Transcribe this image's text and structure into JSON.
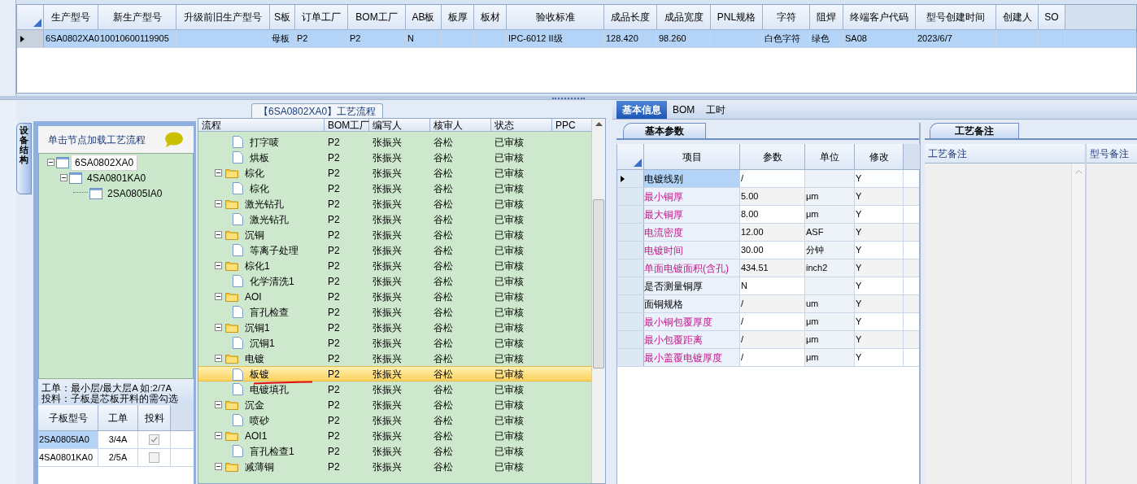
{
  "top_grid": {
    "columns": [
      "生产型号",
      "新生产型号",
      "升级前旧生产型号",
      "S板",
      "订单工厂",
      "BOM工厂",
      "AB板",
      "板厚",
      "板材",
      "验收标准",
      "成品长度",
      "成品宽度",
      "PNL规格",
      "字符",
      "阻焊",
      "终端客户代码",
      "型号创建时间",
      "创建人",
      "SO"
    ],
    "rows": [
      {
        "selected": true,
        "cells": [
          "6SA0802XA0",
          "10010600119905",
          null,
          "母板",
          "P2",
          "P2",
          "N",
          null,
          null,
          "IPC-6012 II级",
          "128.420",
          "98.260",
          null,
          "白色字符",
          "绿色",
          "SA08",
          "2023/6/7",
          null,
          null
        ]
      }
    ]
  },
  "left_panel": {
    "side_tab": "设备结构",
    "hint": "单击节点加载工艺流程",
    "tree": [
      {
        "label": "6SA0802XA0",
        "selected": true,
        "expanded": true,
        "children": [
          {
            "label": "4SA0801KA0",
            "selected": false,
            "expanded": true,
            "children": [
              {
                "label": "2SA0805IA0",
                "selected": false
              }
            ]
          }
        ]
      }
    ],
    "notes": [
      "工单：最小层/最大层A 如:2/7A",
      "投料：子板是芯板开料的需勾选"
    ],
    "sub_grid": {
      "columns": [
        "子板型号",
        "工单",
        "投料"
      ],
      "rows": [
        {
          "board": "2SA0805IA0",
          "order": "3/4A",
          "checked": true,
          "selected": true
        },
        {
          "board": "4SA0801KA0",
          "order": "2/5A",
          "checked": false,
          "selected": false
        }
      ]
    }
  },
  "process": {
    "title": "【6SA0802XA0】工艺流程",
    "columns": [
      "流程",
      "BOM工厂",
      "编写人",
      "核审人",
      "状态",
      "PPC"
    ],
    "tree": [
      {
        "children": [
          {
            "label": "打字唛",
            "kind": "step",
            "selected": false,
            "bom": "P2",
            "writer": "张振兴",
            "reviewer": "谷松",
            "status": "已审核"
          },
          {
            "label": "烘板",
            "kind": "step",
            "selected": false,
            "bom": "P2",
            "writer": "张振兴",
            "reviewer": "谷松",
            "status": "已审核"
          }
        ]
      },
      {
        "label": "棕化",
        "kind": "folder",
        "expanded": true,
        "selected": false,
        "bom": "P2",
        "writer": "张振兴",
        "reviewer": "谷松",
        "status": "已审核",
        "children": [
          {
            "label": "棕化",
            "kind": "step",
            "selected": false,
            "bom": "P2",
            "writer": "张振兴",
            "reviewer": "谷松",
            "status": "已审核"
          }
        ]
      },
      {
        "label": "激光钻孔",
        "kind": "folder",
        "expanded": true,
        "selected": false,
        "bom": "P2",
        "writer": "张振兴",
        "reviewer": "谷松",
        "status": "已审核",
        "children": [
          {
            "label": "激光钻孔",
            "kind": "step",
            "selected": false,
            "bom": "P2",
            "writer": "张振兴",
            "reviewer": "谷松",
            "status": "已审核"
          }
        ]
      },
      {
        "label": "沉铜",
        "kind": "folder",
        "expanded": true,
        "selected": false,
        "bom": "P2",
        "writer": "张振兴",
        "reviewer": "谷松",
        "status": "已审核",
        "children": [
          {
            "label": "等离子处理",
            "kind": "step",
            "selected": false,
            "bom": "P2",
            "writer": "张振兴",
            "reviewer": "谷松",
            "status": "已审核"
          }
        ]
      },
      {
        "label": "棕化1",
        "kind": "folder",
        "expanded": true,
        "selected": false,
        "bom": "P2",
        "writer": "张振兴",
        "reviewer": "谷松",
        "status": "已审核",
        "children": [
          {
            "label": "化学清洗1",
            "kind": "step",
            "selected": false,
            "bom": "P2",
            "writer": "张振兴",
            "reviewer": "谷松",
            "status": "已审核"
          }
        ]
      },
      {
        "label": "AOI",
        "kind": "folder",
        "expanded": true,
        "selected": false,
        "bom": "P2",
        "writer": "张振兴",
        "reviewer": "谷松",
        "status": "已审核",
        "children": [
          {
            "label": "盲孔检查",
            "kind": "step",
            "selected": false,
            "bom": "P2",
            "writer": "张振兴",
            "reviewer": "谷松",
            "status": "已审核"
          }
        ]
      },
      {
        "label": "沉铜1",
        "kind": "folder",
        "expanded": true,
        "selected": false,
        "bom": "P2",
        "writer": "张振兴",
        "reviewer": "谷松",
        "status": "已审核",
        "children": [
          {
            "label": "沉铜1",
            "kind": "step",
            "selected": false,
            "bom": "P2",
            "writer": "张振兴",
            "reviewer": "谷松",
            "status": "已审核"
          }
        ]
      },
      {
        "label": "电镀",
        "kind": "folder",
        "expanded": true,
        "selected": false,
        "bom": "P2",
        "writer": "张振兴",
        "reviewer": "谷松",
        "status": "已审核",
        "children": [
          {
            "label": "板镀",
            "kind": "step",
            "selected": true,
            "bom": "P2",
            "writer": "张振兴",
            "reviewer": "谷松",
            "status": "已审核"
          },
          {
            "label": "电镀填孔",
            "kind": "step",
            "selected": false,
            "bom": "P2",
            "writer": "张振兴",
            "reviewer": "谷松",
            "status": "已审核"
          }
        ]
      },
      {
        "label": "沉金",
        "kind": "folder",
        "expanded": true,
        "selected": false,
        "bom": "P2",
        "writer": "张振兴",
        "reviewer": "谷松",
        "status": "已审核",
        "children": [
          {
            "label": "喷砂",
            "kind": "step",
            "selected": false,
            "bom": "P2",
            "writer": "张振兴",
            "reviewer": "谷松",
            "status": "已审核"
          }
        ]
      },
      {
        "label": "AOI1",
        "kind": "folder",
        "expanded": true,
        "selected": false,
        "bom": "P2",
        "writer": "张振兴",
        "reviewer": "谷松",
        "status": "已审核",
        "children": [
          {
            "label": "盲孔检查1",
            "kind": "step",
            "selected": false,
            "bom": "P2",
            "writer": "张振兴",
            "reviewer": "谷松",
            "status": "已审核"
          }
        ]
      },
      {
        "label": "减薄铜",
        "kind": "folder",
        "expanded": true,
        "selected": false,
        "bom": "P2",
        "writer": "张振兴",
        "reviewer": "谷松",
        "status": "已审核"
      }
    ]
  },
  "detail": {
    "tabs": [
      {
        "label": "基本信息",
        "selected": true
      },
      {
        "label": "BOM",
        "selected": false
      },
      {
        "label": "工时",
        "selected": false
      }
    ],
    "params_tab": "基本参数",
    "params": {
      "columns": [
        "项目",
        "参数",
        "单位",
        "修改"
      ],
      "rows": [
        {
          "item": "电镀线别",
          "value": "/",
          "unit": null,
          "modify": "Y",
          "required": false,
          "current": true
        },
        {
          "item": "最小铜厚",
          "value": "5.00",
          "unit": "μm",
          "modify": "Y",
          "required": true,
          "current": false
        },
        {
          "item": "最大铜厚",
          "value": "8.00",
          "unit": "μm",
          "modify": "Y",
          "required": true,
          "current": false
        },
        {
          "item": "电流密度",
          "value": "12.00",
          "unit": "ASF",
          "modify": "Y",
          "required": true,
          "current": false
        },
        {
          "item": "电镀时间",
          "value": "30.00",
          "unit": "分钟",
          "modify": "Y",
          "required": true,
          "current": false
        },
        {
          "item": "单面电镀面积(含孔)",
          "value": "434.51",
          "unit": "inch2",
          "modify": "Y",
          "required": true,
          "current": false
        },
        {
          "item": "是否测量铜厚",
          "value": "N",
          "unit": null,
          "modify": "Y",
          "required": false,
          "current": false
        },
        {
          "item": "面铜规格",
          "value": "/",
          "unit": "um",
          "modify": "Y",
          "required": false,
          "current": false
        },
        {
          "item": "最小铜包覆厚度",
          "value": "/",
          "unit": "μm",
          "modify": "Y",
          "required": true,
          "current": false
        },
        {
          "item": "最小包覆距离",
          "value": "/",
          "unit": "μm",
          "modify": "Y",
          "required": true,
          "current": false
        },
        {
          "item": "最小盖覆电镀厚度",
          "value": "/",
          "unit": "μm",
          "modify": "Y",
          "required": true,
          "current": false
        }
      ]
    },
    "notes_tab": "工艺备注",
    "notes_columns": [
      "工艺备注",
      "型号备注"
    ]
  }
}
